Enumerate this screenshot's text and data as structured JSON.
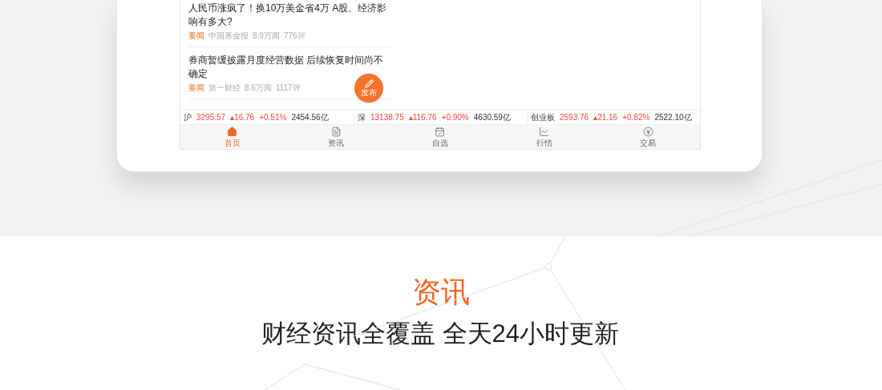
{
  "news": [
    {
      "title": "人民币涨疯了！换10万美金省4万 A股、经济影响有多大?",
      "tag": "要闻",
      "source": "中国基金报",
      "reads": "8.9万阅",
      "comments": "776评"
    },
    {
      "title": "券商暂缓披露月度经营数据 后续恢复时间尚不确定",
      "tag": "要闻",
      "source": "第一财经",
      "reads": "8.6万阅",
      "comments": "1117评"
    }
  ],
  "fab": {
    "label": "发布"
  },
  "ticker": [
    {
      "name": "沪",
      "price": "3295.57",
      "change": "▴16.76",
      "percent": "+0.51%",
      "turnover": "2454.56亿"
    },
    {
      "name": "深",
      "price": "13138.75",
      "change": "▴116.76",
      "percent": "+0.90%",
      "turnover": "4630.59亿"
    },
    {
      "name": "创业板",
      "price": "2593.76",
      "change": "▴21.16",
      "percent": "+0.82%",
      "turnover": "2522.10亿"
    }
  ],
  "nav": [
    {
      "label": "首页",
      "kind": "home",
      "selected": true
    },
    {
      "label": "资讯",
      "kind": "news",
      "selected": false
    },
    {
      "label": "自选",
      "kind": "watchlist",
      "selected": false
    },
    {
      "label": "行情",
      "kind": "market",
      "selected": false
    },
    {
      "label": "交易",
      "kind": "trade",
      "selected": false
    }
  ],
  "section": {
    "title": "资讯",
    "subtitle": "财经资讯全覆盖 全天24小时更新"
  }
}
